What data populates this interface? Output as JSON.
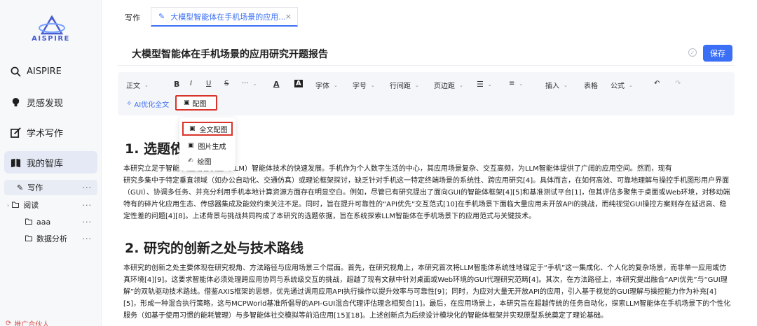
{
  "sidebar": {
    "logo_text": "AISPIRE",
    "nav": [
      {
        "label": "AISPIRE",
        "icon": "search-icon"
      },
      {
        "label": "灵感发现",
        "icon": "bulb-icon"
      },
      {
        "label": "学术写作",
        "icon": "edit-icon"
      },
      {
        "label": "我的智库",
        "icon": "book-icon"
      }
    ],
    "tree": [
      {
        "label": "写作",
        "icon": "pen-icon",
        "more": "···"
      },
      {
        "label": "阅读",
        "icon": "folder-icon",
        "more": "···"
      },
      {
        "label": "aaa",
        "icon": "folder-icon",
        "more": "···"
      },
      {
        "label": "数据分析",
        "icon": "folder-icon",
        "more": "···"
      }
    ],
    "promo": "推广合伙人"
  },
  "tabs": {
    "plain": "写作",
    "active": "大模型智能体在手机场景的应用...",
    "close": "×"
  },
  "document": {
    "title": "大模型智能体在手机场景的应用研究开题报告",
    "save_label": "保存"
  },
  "toolbar": {
    "items": [
      "正文",
      "B",
      "I",
      "U",
      "S",
      "···",
      "A",
      "A",
      "字体",
      "字号",
      "行间距",
      "页边距",
      "☰",
      "≡",
      "插入",
      "表格",
      "公式",
      "↶",
      "↷"
    ],
    "ai_optimize": "AI优化全文",
    "peitu": "配图"
  },
  "dropdown": {
    "items": [
      "全文配图",
      "图片生成",
      "绘图"
    ]
  },
  "content": {
    "heading1": "1. 选题依",
    "heading1_tail": "",
    "para1": [
      "本研究立足于智能   大型语言模型（LLM）智能体技术的快速发展。手机作为个人数字生活的中心，其应用场景复杂、交互高频，为LLM智能体提供了广阔的应用空间。然而，现有",
      "研究多集中于特定垂直领域（如办公自动化、交通仿真）或理论框架探讨，缺乏针对手机这一特定终端场景的系统性、跨应用研究[4]。具体而言，在如何高效、可靠地理解与操控手机图形用户界面",
      "（GUI）、协调多任务、并充分利用手机本地计算资源方面存在明显空白。例如，尽管已有研究提出了面向GUI的智能体框架[4][5]和基准测试平台[1]，但其评估多聚焦于桌面或Web环境，对移动端",
      "特有的碎片化应用生态、传感器集成及能效约束关注不足。同时，旨在提升可靠性的“API优先”交互范式[10]在手机场景下面临大量应用未开放API的挑战，而纯视觉GUI操控方案则存在延迟高、稳",
      "定性差的问题[4][8]。上述背景与挑战共同构成了本研究的选题依据，旨在系统探索LLM智能体在手机场景下的应用范式与关键技术。"
    ],
    "heading2": "2. 研究的创新之处与技术路线",
    "para2": [
      "本研究的创新之处主要体现在研究视角、方法路径与应用场景三个层面。首先，在研究视角上，本研究首次将LLM智能体系统性地锚定于“手机”这一集成化、个人化的复杂场景，而非单一应用或仿",
      "真环境[4][9]。这要求智能体必须处理跨应用协同与系统级交互的挑战，超越了现有文献中针对桌面或Web环境的GUI代理研究范畴[4]。其次，在方法路径上，本研究提出融合“API优先”与“GUI理",
      "解”的双轨驱动技术路线。借鉴AXIS框架的思想，优先通过调用应用API执行操作以提升效率与可靠性[9]；同时，为应对大量无开放API的应用，引入基于视觉的GUI理解与操控能力作为补充[4]",
      "[5]，形成一种混合执行策略，这与MCPWorld基准所倡导的API-GUI混合代理评估理念相契合[1]。最后，在应用场景上，本研究旨在超越传统的任务自动化，探索LLM智能体在手机场景下的个性化",
      "服务（如基于使用习惯的能耗管理）与多智能体社交模拟等前沿应用[15][18]。上述创新点为后续设计模块化的智能体框架并实现原型系统奠定了理论基础。"
    ]
  },
  "colors": {
    "accent": "#3b6ff5",
    "highlight_box": "#d9342b",
    "sidebar_bg": "#f7f8fa"
  }
}
